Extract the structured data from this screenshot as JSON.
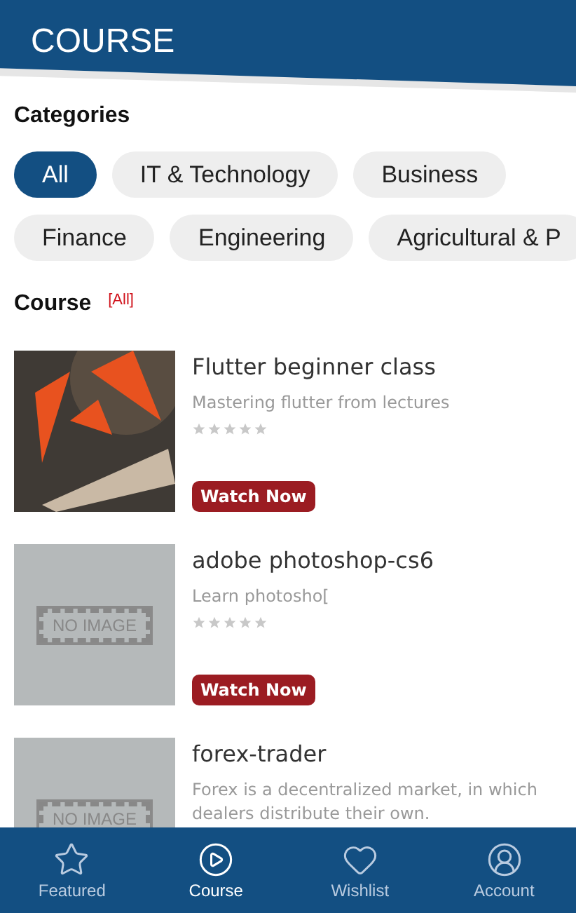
{
  "header": {
    "title": "COURSE"
  },
  "categories": {
    "title": "Categories",
    "rows": [
      [
        {
          "label": "All",
          "selected": true
        },
        {
          "label": "IT & Technology",
          "selected": false
        },
        {
          "label": "Business",
          "selected": false
        }
      ],
      [
        {
          "label": "Finance",
          "selected": false
        },
        {
          "label": "Engineering",
          "selected": false
        },
        {
          "label": "Agricultural & P",
          "selected": false
        }
      ]
    ]
  },
  "course_section": {
    "title": "Course",
    "filter": "[All]"
  },
  "courses": [
    {
      "kind": "picture",
      "title": "Flutter beginner class",
      "description": "Mastering flutter from lectures",
      "stars": 0,
      "button": "Watch Now"
    },
    {
      "kind": "placeholder",
      "placeholder_text": "NO IMAGE",
      "title": "adobe photoshop-cs6",
      "description": "Learn photosho[",
      "stars": 0,
      "button": "Watch Now"
    },
    {
      "kind": "placeholder",
      "placeholder_text": "NO IMAGE",
      "title": "forex-trader",
      "description": "Forex is a decentralized market, in which dealers distribute their own."
    }
  ],
  "bottom_nav": [
    {
      "kind": "star",
      "label": "Featured",
      "selected": false
    },
    {
      "kind": "play",
      "label": "Course",
      "selected": true
    },
    {
      "kind": "heart",
      "label": "Wishlist",
      "selected": false
    },
    {
      "kind": "account",
      "label": "Account",
      "selected": false
    }
  ]
}
